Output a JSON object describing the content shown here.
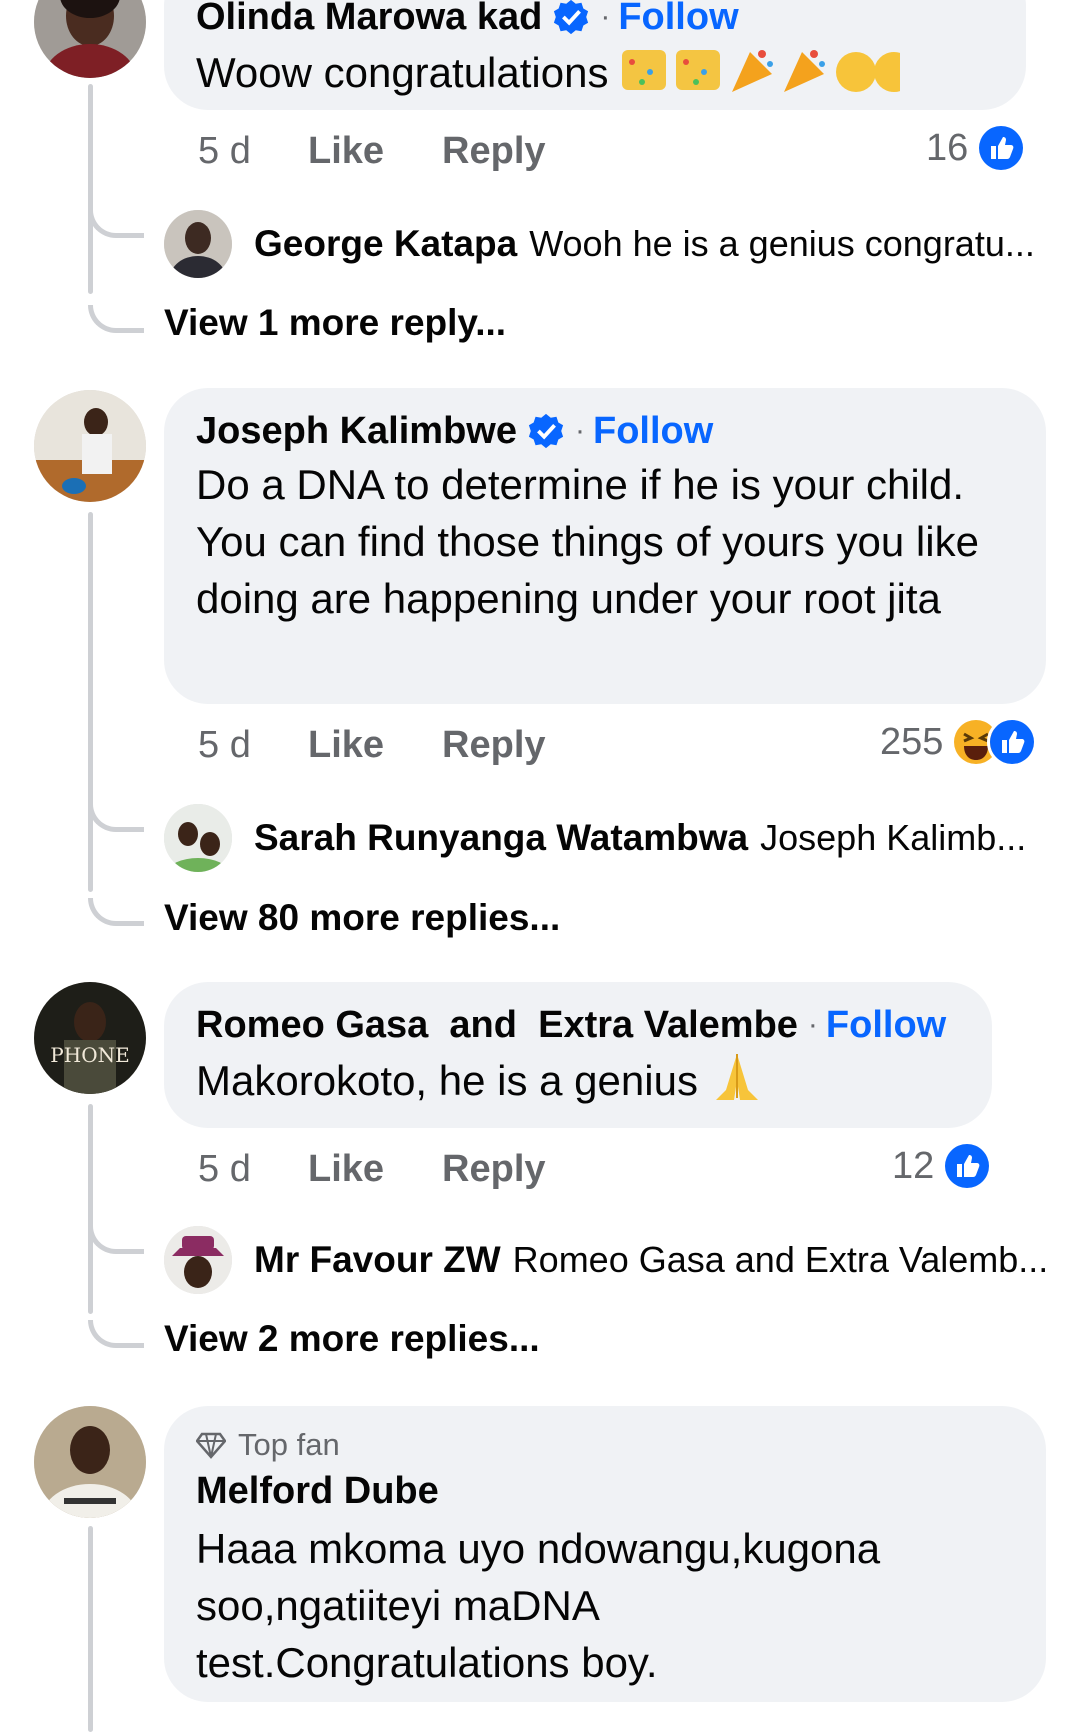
{
  "comments": [
    {
      "name": "Olinda Marowa kad",
      "follow": "Follow",
      "text": "Woow congratulations",
      "time": "5 d",
      "like": "Like",
      "reply": "Reply",
      "reaction_count": "16",
      "reply_preview": {
        "name": "George Katapa",
        "text": "Wooh he is a genius  congratu..."
      },
      "view_more": "View 1 more reply..."
    },
    {
      "name": "Joseph Kalimbwe",
      "follow": "Follow",
      "text": "Do a DNA to determine if he is your child. You can find those things of yours you like doing are happening under your root jita",
      "time": "5 d",
      "like": "Like",
      "reply": "Reply",
      "reaction_count": "255",
      "reply_preview": {
        "name": "Sarah Runyanga Watambwa",
        "text": "Joseph Kalimb..."
      },
      "view_more": "View 80 more replies..."
    },
    {
      "name": "Romeo Gasa  and  Extra Valembe",
      "follow": "Follow",
      "text": "Makorokoto, he is a genius",
      "time": "5 d",
      "like": "Like",
      "reply": "Reply",
      "reaction_count": "12",
      "reply_preview": {
        "name": "Mr Favour ZW",
        "text": "Romeo Gasa and Extra Valemb..."
      },
      "view_more": "View 2 more replies..."
    },
    {
      "badge": "Top fan",
      "name": "Melford Dube",
      "text": "Haaa mkoma uyo ndowangu,kugona soo,ngatiiteyi maDNA test.Congratulations boy."
    }
  ],
  "colors": {
    "accent": "#0866ff",
    "bubble": "#f0f2f5",
    "meta": "#65676b",
    "thread": "#ced0d4"
  },
  "icons": [
    "verified-badge-icon",
    "like-reaction-icon",
    "haha-reaction-icon",
    "top-fan-diamond-icon",
    "party-popper-icon",
    "clapping-hands-icon",
    "folded-hands-icon"
  ],
  "avatar_logo_text": "PHONE"
}
